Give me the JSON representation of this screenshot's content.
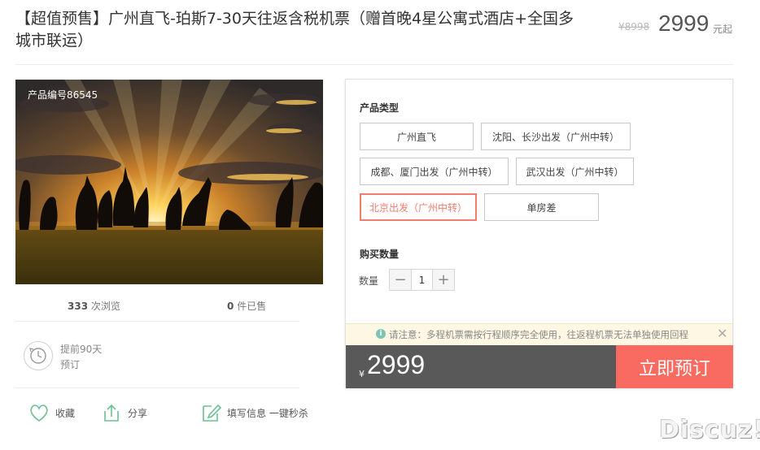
{
  "header": {
    "title": "【超值预售】广州直飞-珀斯7-30天往返含税机票（赠首晚4星公寓式酒店+全国多城市联运）",
    "original_price": "¥8998",
    "price": "2999",
    "price_unit": "元起"
  },
  "photo": {
    "product_number": "产品编号86545"
  },
  "stats": {
    "views_count": "333",
    "views_label": "次浏览",
    "sold_count": "0",
    "sold_label": "件已售"
  },
  "advance": {
    "line1": "提前90天",
    "line2": "预订"
  },
  "actions": {
    "favorite": "收藏",
    "share": "分享",
    "fill_info": "填写信息 一键秒杀"
  },
  "options": {
    "type_label": "产品类型",
    "items": [
      "广州直飞",
      "沈阳、长沙出发（广州中转）",
      "成都、厦门出发（广州中转）",
      "武汉出发（广州中转）",
      "北京出发（广州中转）",
      "单房差"
    ],
    "selected_index": 4,
    "qty_section_label": "购买数量",
    "qty_label": "数量",
    "qty_minus": "−",
    "qty_value": "1",
    "qty_plus": "+"
  },
  "notice": {
    "icon": "i",
    "text": "请注意：多程机票需按行程顺序完全使用，往返程机票无法单独使用回程",
    "close": "✕"
  },
  "purchase": {
    "currency": "¥",
    "price": "2999",
    "book_label": "立即预订"
  },
  "watermark": "Discuz!",
  "colors": {
    "accent": "#f96b61",
    "selected_border": "#f07d6e",
    "bar_bg": "#595959",
    "notice_bg": "#fdf7e3",
    "icon_green": "#6cbf8f"
  }
}
